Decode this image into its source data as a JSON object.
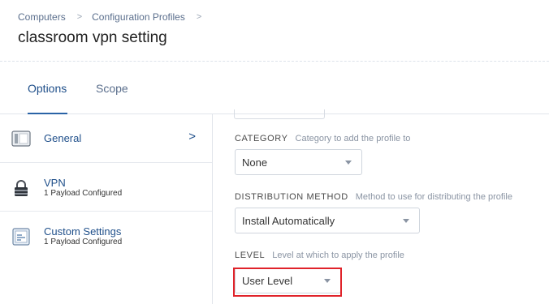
{
  "breadcrumb": {
    "items": [
      "Computers",
      "Configuration Profiles"
    ],
    "separator": ">"
  },
  "page": {
    "title": "classroom vpn setting"
  },
  "tabs": [
    {
      "label": "Options",
      "active": true
    },
    {
      "label": "Scope",
      "active": false
    }
  ],
  "sidebar": {
    "items": [
      {
        "label": "General",
        "sub": "",
        "icon": "general-settings-icon",
        "chevron": ">"
      },
      {
        "label": "VPN",
        "sub": "1 Payload Configured",
        "icon": "lock-icon"
      },
      {
        "label": "Custom Settings",
        "sub": "1 Payload Configured",
        "icon": "custom-settings-icon"
      }
    ]
  },
  "form": {
    "category": {
      "label": "CATEGORY",
      "hint": "Category to add the profile to",
      "value": "None"
    },
    "distribution": {
      "label": "DISTRIBUTION METHOD",
      "hint": "Method to use for distributing the profile",
      "value": "Install Automatically"
    },
    "level": {
      "label": "LEVEL",
      "hint": "Level at which to apply the profile",
      "value": "User Level"
    }
  },
  "colors": {
    "accent": "#1f4f8a",
    "highlight": "#e0232a",
    "link": "#5a6e8c"
  }
}
